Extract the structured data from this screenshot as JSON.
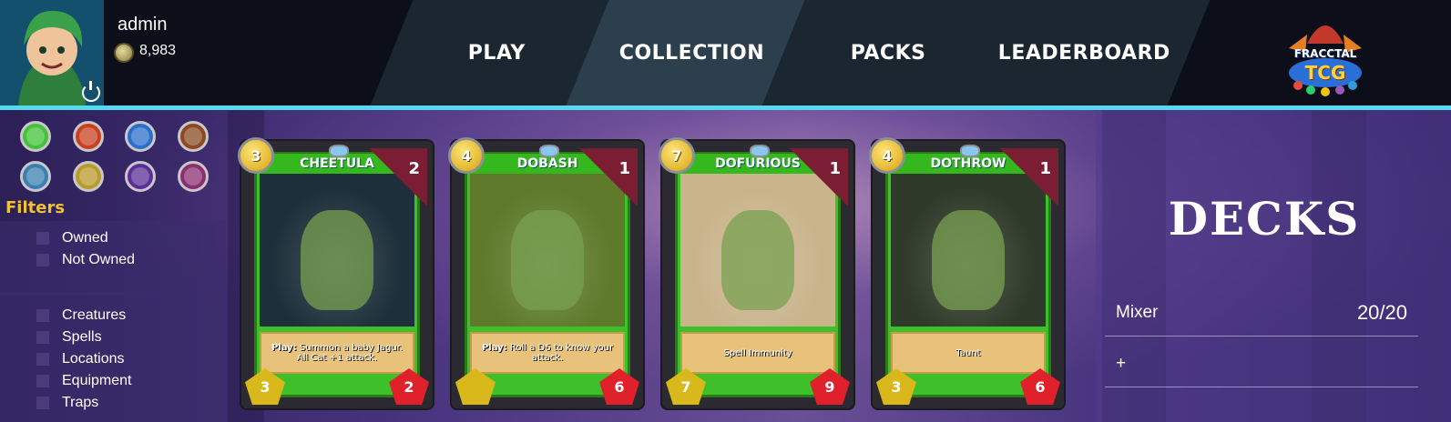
{
  "player": {
    "name": "admin",
    "coins": "8,983"
  },
  "nav": {
    "play": "PLAY",
    "collection": "COLLECTION",
    "packs": "PACKS",
    "leaderboard": "LEADERBOARD"
  },
  "logo": {
    "line1": "FRACCTAL",
    "line2": "TCG"
  },
  "elements": [
    {
      "icon": "leaf-icon",
      "color": "#44c23a"
    },
    {
      "icon": "fire-icon",
      "color": "#c8401f"
    },
    {
      "icon": "water-icon",
      "color": "#2c6fc9"
    },
    {
      "icon": "earth-icon",
      "color": "#8a4a22"
    },
    {
      "icon": "ice-icon",
      "color": "#3a7fb0"
    },
    {
      "icon": "light-icon",
      "color": "#b99a2a"
    },
    {
      "icon": "dark-icon",
      "color": "#5a2f96"
    },
    {
      "icon": "spiral-icon",
      "color": "#8a2f6f"
    }
  ],
  "filters": {
    "title": "Filters",
    "ownership": [
      "Owned",
      "Not Owned"
    ],
    "types": [
      "Creatures",
      "Spells",
      "Locations",
      "Equipment",
      "Traps"
    ]
  },
  "cards": [
    {
      "name": "CHEETULA",
      "cost": "3",
      "count": "2",
      "ability_label": "Play:",
      "ability": "Summon a baby Jagur. All Cat +1 attack.",
      "attack": "3",
      "health": "2",
      "art_color": "#1d2f3a"
    },
    {
      "name": "DOBASH",
      "cost": "4",
      "count": "1",
      "ability_label": "Play:",
      "ability": "Roll a D6 to know your attack.",
      "attack": "",
      "health": "6",
      "art_color": "#5e7a2a"
    },
    {
      "name": "DOFURIOUS",
      "cost": "7",
      "count": "1",
      "ability_label": "",
      "ability": "Spell Immunity",
      "attack": "7",
      "health": "9",
      "art_color": "#c9b48c"
    },
    {
      "name": "DOTHROW",
      "cost": "4",
      "count": "1",
      "ability_label": "",
      "ability": "Taunt",
      "attack": "3",
      "health": "6",
      "art_color": "#2f3a2a"
    }
  ],
  "decks": {
    "title": "DECKS",
    "items": [
      {
        "name": "Mixer",
        "count": "20/20"
      }
    ],
    "add_label": "+"
  }
}
